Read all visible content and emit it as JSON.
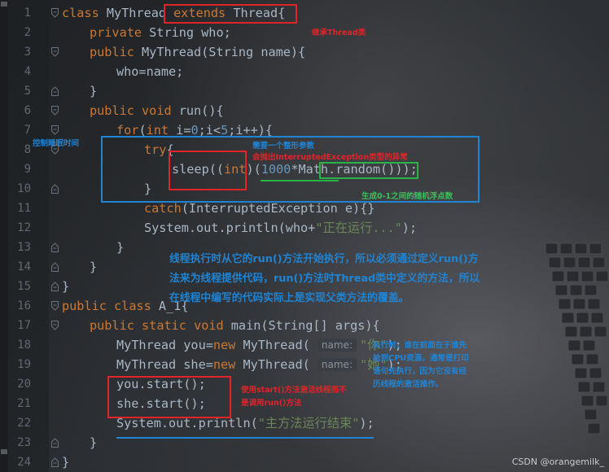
{
  "editor": {
    "line_numbers": [
      "1",
      "2",
      "3",
      "4",
      "5",
      "6",
      "7",
      "8",
      "9",
      "10",
      "11",
      "12",
      "13",
      "14",
      "15",
      "16",
      "17",
      "18",
      "19",
      "20",
      "21",
      "22",
      "23",
      "24"
    ],
    "code": {
      "l1": {
        "kw1": "class",
        "t1": " MyThread ",
        "kw2": "extends",
        "t2": " Thread{"
      },
      "l2": {
        "kw1": "private",
        "t1": " String who;"
      },
      "l3": {
        "kw1": "public",
        "t1": " MyThread(String name){"
      },
      "l4": {
        "t1": "who=name;"
      },
      "l5": {
        "t1": "}"
      },
      "l6": {
        "kw1": "public",
        "t1": " ",
        "kw2": "void",
        "t2": " run(){"
      },
      "l7": {
        "kw1": "for",
        "t1": "(",
        "kw2": "int",
        "t2": " i=",
        "n1": "0",
        "t3": ";i<",
        "n2": "5",
        "t4": ";i++){"
      },
      "l8": {
        "kw1": "try",
        "t1": "{"
      },
      "l9": {
        "t1": "sleep((",
        "kw1": "int",
        "t2": ")(",
        "n1": "1000",
        "t3": "*Math.random()));"
      },
      "l10": {
        "t1": "}"
      },
      "l11": {
        "kw1": "catch",
        "t1": "(InterruptedException e){}"
      },
      "l12": {
        "t1": "System.out.println(who+",
        "s1": "\"正在运行...\"",
        "t2": ");"
      },
      "l13": {
        "t1": "}"
      },
      "l14": {
        "t1": "}"
      },
      "l15": {
        "t1": "}"
      },
      "l16": {
        "kw1": "public",
        "t1": " ",
        "kw2": "class",
        "t2": " A_1{"
      },
      "l17": {
        "kw1": "public",
        "t1": " ",
        "kw2": "static",
        "t2": " ",
        "kw3": "void",
        "t3": " main(String[] args){"
      },
      "l18": {
        "t1": "MyThread you=",
        "kw1": "new",
        "t2": " MyThread( ",
        "hint": "name:",
        "s1": "\"你\"",
        "t3": ");"
      },
      "l19": {
        "t1": "MyThread she=",
        "kw1": "new",
        "t2": " MyThread( ",
        "hint": "name:",
        "s1": "\"她\"",
        "t3": ");"
      },
      "l20": {
        "t1": "you.start();"
      },
      "l21": {
        "t1": "she.start();"
      },
      "l22": {
        "t1": "System.out.println(",
        "s1": "\"主方法运行结束\"",
        "t2": ");"
      },
      "l23": {
        "t1": "}"
      },
      "l24": {
        "t1": "}"
      }
    }
  },
  "annotations": {
    "inherit": "继承Thread类",
    "control_sleep": "控制睡眠时间",
    "need_int": "需要一个整形参数",
    "throws": "会抛出InterruptedException类型的异常",
    "random": "生成0-1之间的随机浮点数",
    "run_explain": "线程执行时从它的run()方法开始执行，所以必须通过定义run()方\n法来为线程提供代码，run()方法时Thread类中定义的方法，所以\n在线程中编写的代码实际上是实现父类方法的覆盖。",
    "exec_order": "执行时，谁在前面在于谁先\n抢到CPU资源，通常是打印\n语句先执行，因为它没有经\n历线程的激活操作。",
    "start_note": "使用start()方法激活线程而不\n是调用run()方法"
  },
  "watermark": "CSDN @orangemilk_",
  "colors": {
    "keyword": "#cc7832",
    "number": "#6897bb",
    "string": "#6a8759",
    "text": "#a9b7c6",
    "annotation_red": "#e0242a",
    "annotation_blue": "#1f84d4",
    "annotation_green": "#3cc05a"
  }
}
